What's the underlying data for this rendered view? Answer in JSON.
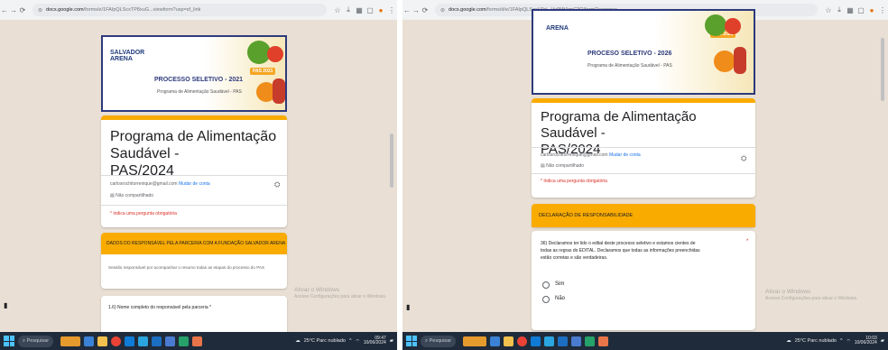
{
  "left": {
    "browser": {
      "url_host": "docs.google.com",
      "url_path": "/forms/e/1FAIpQLScxTP8xuG...viewform?usp=sf_link"
    },
    "banner": {
      "logo_line1": "SALVADOR",
      "logo_line2": "ARENA",
      "tag": "PAS 2021",
      "title": "PROCESSO SELETIVO - 2021",
      "subtitle": "Programa de Alimentação Saudável - PAS"
    },
    "form": {
      "title_line1": "Programa de Alimentação Saudável -",
      "title_line2": "PAS/2024",
      "account_email": "carlosrochitorrenique@gmail.com",
      "switch_account": "Mudar de conta",
      "not_shared": "Não compartilhado",
      "required_note": "* Indica uma pergunta obrigatória"
    },
    "section": {
      "title": "DADOS DO RESPONSÁVEL PELA PARCERIA COM A FUNDAÇÃO SALVADOR ARENA",
      "description": "Sessão responsável por acompanhar o resumo todas as etapas do processo do PAS"
    },
    "question": {
      "label": "1.6) Nome completo do responsável pela parceria *"
    },
    "watermark": {
      "line1": "Ativar o Windows",
      "line2": "Acesse Configurações para ativar o Windows."
    },
    "taskbar": {
      "search": "Pesquisar",
      "weather": "25°C Parc nublado",
      "time": "09:47",
      "date": "10/06/2024"
    }
  },
  "right": {
    "browser": {
      "url_host": "docs.google.com",
      "url_path": "/forms/d/e/1FAIpQLSecH0d...Vv9Mt4gpC3Q/formResponse"
    },
    "banner": {
      "logo_line1": "ARENA",
      "tag": "PAS 2021",
      "title": "PROCESO SELETIVO - 2026",
      "subtitle": "Programa de Alimentação Saudável - PAS"
    },
    "form": {
      "title_line1": "Programa de Alimentação Saudável -",
      "title_line2": "PAS/2024",
      "account_email": "carlosrochitorrenique@gmail.com",
      "switch_account": "Mudar de conta",
      "not_shared": "Não compartilhado",
      "required_note": "* Indica uma pergunta obrigatória"
    },
    "section": {
      "title": "DECLARAÇÃO DE RESPONSABILIDADE"
    },
    "question": {
      "label_line1": "36) Declaramos ter lido o edital deste processo seletivo e estamos cientes de",
      "label_line2": "todas as regras do EDITAL. Declaramos que todas as informações preenchidas",
      "label_line3": "estão corretas e são verdadeiras.",
      "required_mark": "*",
      "options": [
        "Sim",
        "Não"
      ]
    },
    "watermark": {
      "line1": "Ativar o Windows",
      "line2": "Acesse Configurações para ativar o Windows."
    },
    "taskbar": {
      "search": "Pesquisar",
      "weather": "25°C Parc nublado",
      "time": "10:03",
      "date": "10/06/2024"
    }
  },
  "colors": {
    "accent": "#f9ab00",
    "page_bg": "#e9dfd4",
    "taskbar": "#1f2b3a",
    "link": "#1a73e8",
    "required": "#d93025"
  }
}
